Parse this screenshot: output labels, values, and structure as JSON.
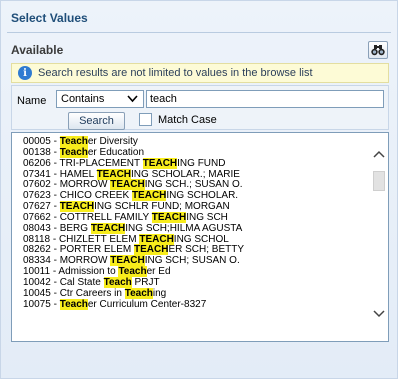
{
  "dialog": {
    "title": "Select Values",
    "available_label": "Available",
    "find_icon": "binoculars-icon"
  },
  "info": {
    "icon": "info-icon",
    "text": "Search results are not limited to values in the browse list"
  },
  "search": {
    "name_label": "Name",
    "operator": "Contains",
    "value": "teach",
    "search_button": "Search",
    "match_case_label": "Match Case",
    "match_case_checked": false
  },
  "results": [
    {
      "pre": "00005 - ",
      "hl": "Teach",
      "post": "er Diversity"
    },
    {
      "pre": "00138 - ",
      "hl": "Teach",
      "post": "er Education"
    },
    {
      "pre": "06206 - TRI-PLACEMENT ",
      "hl": "TEACH",
      "post": "ING FUND"
    },
    {
      "pre": "07341 - HAMEL ",
      "hl": "TEACH",
      "post": "ING SCHOLAR.; MARIE"
    },
    {
      "pre": "07602 - MORROW ",
      "hl": "TEACH",
      "post": "ING SCH.; SUSAN O."
    },
    {
      "pre": "07623 - CHICO CREEK ",
      "hl": "TEACH",
      "post": "ING SCHOLAR."
    },
    {
      "pre": "07627 - ",
      "hl": "TEACH",
      "post": "ING SCHLR FUND; MORGAN"
    },
    {
      "pre": "07662 - COTTRELL FAMILY ",
      "hl": "TEACH",
      "post": "ING SCH"
    },
    {
      "pre": "08043 - BERG ",
      "hl": "TEACH",
      "post": "ING SCH;HILMA AGUSTA"
    },
    {
      "pre": "08118 - CHIZLETT ELEM ",
      "hl": "TEACH",
      "post": "ING SCHOL"
    },
    {
      "pre": "08262 - PORTER ELEM ",
      "hl": "TEACH",
      "post": "ER SCH; BETTY"
    },
    {
      "pre": "08334 - MORROW ",
      "hl": "TEACH",
      "post": "ING SCH; SUSAN O."
    },
    {
      "pre": "10011 - Admission to ",
      "hl": "Teach",
      "post": "er Ed"
    },
    {
      "pre": "10042 - Cal State ",
      "hl": "Teach",
      "post": " PRJT"
    },
    {
      "pre": "10045 - Ctr Careers in ",
      "hl": "Teach",
      "post": "ing"
    },
    {
      "pre": "10075 - ",
      "hl": "Teach",
      "post": "er Curriculum Center-8327"
    }
  ],
  "colors": {
    "highlight": "#f8ed1c",
    "title": "#1f4e79",
    "info_bg": "#fdfbd6"
  }
}
